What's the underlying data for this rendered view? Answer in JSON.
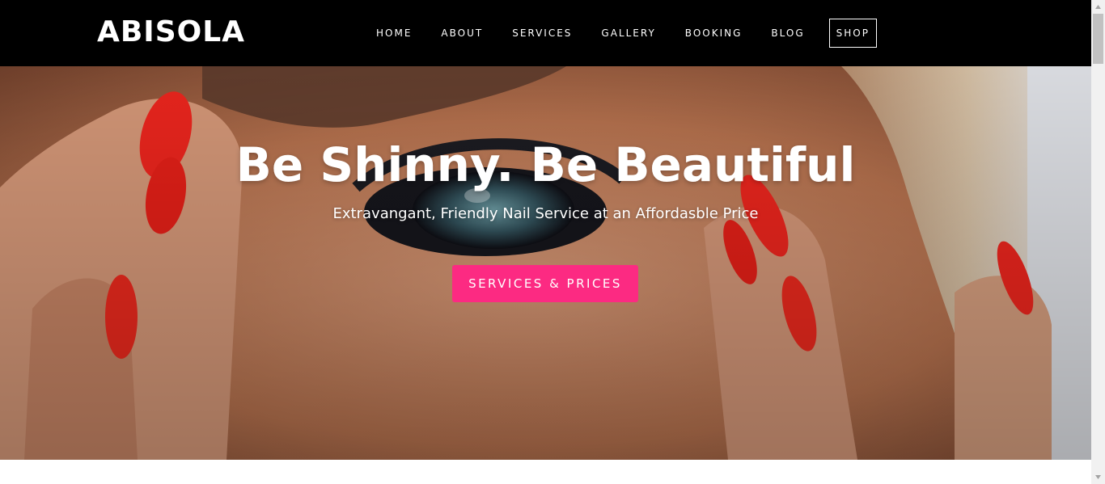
{
  "brand": {
    "logo_text": "ABISOLA"
  },
  "nav": {
    "items": [
      {
        "label": "HOME"
      },
      {
        "label": "ABOUT"
      },
      {
        "label": "SERVICES"
      },
      {
        "label": "GALLERY"
      },
      {
        "label": "BOOKING"
      },
      {
        "label": "BLOG"
      },
      {
        "label": "SHOP"
      }
    ]
  },
  "hero": {
    "headline": "Be Shinny. Be Beautiful",
    "subheadline": "Extravangant, Friendly Nail Service at an Affordasble Price",
    "cta_label": "SERVICES & PRICES",
    "background_icon": "hero-photo-face-red-nails"
  },
  "colors": {
    "header_bg": "#000000",
    "cta_bg": "#fc2a82",
    "text_light": "#ffffff",
    "nail_red": "#f0261e"
  }
}
